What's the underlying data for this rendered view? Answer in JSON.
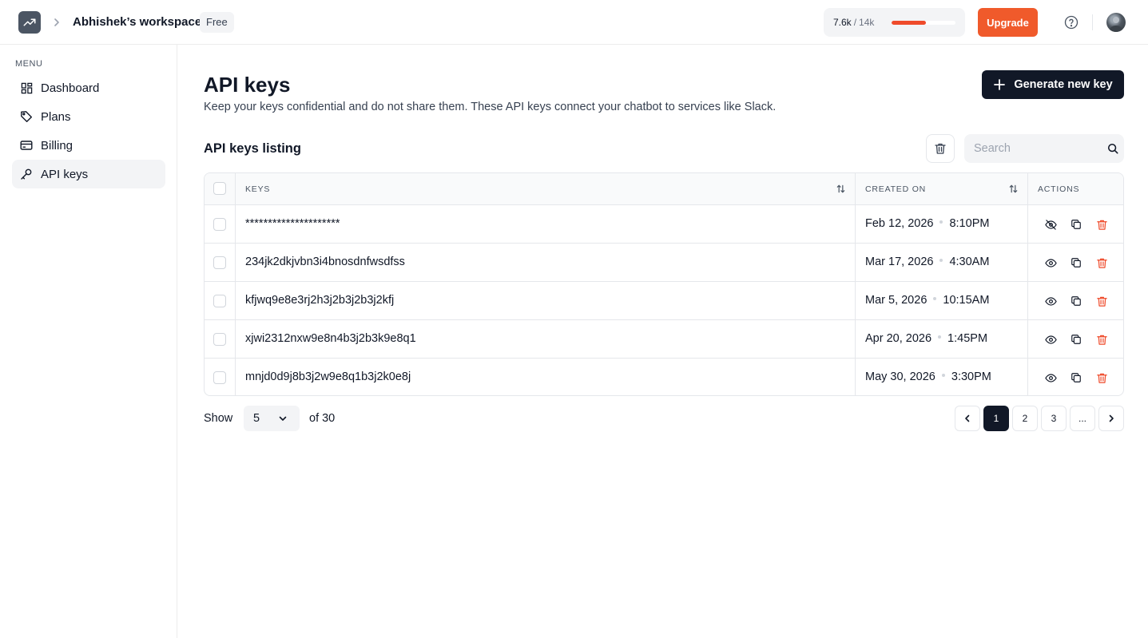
{
  "header": {
    "workspace_name": "Abhishek’s workspace",
    "plan_badge": "Free",
    "usage": {
      "used": "7.6k",
      "separator": "/",
      "limit": "14k",
      "fraction": 0.54
    },
    "upgrade_label": "Upgrade",
    "icons": {
      "logo": "trend-up-icon",
      "breadcrumb": "chevron-right-icon",
      "help": "help-circle-icon",
      "avatar": "user-avatar"
    }
  },
  "sidebar": {
    "menu_label": "MENU",
    "items": [
      {
        "label": "Dashboard",
        "icon": "dashboard-icon",
        "active": false
      },
      {
        "label": "Plans",
        "icon": "tag-icon",
        "active": false
      },
      {
        "label": "Billing",
        "icon": "credit-card-icon",
        "active": false
      },
      {
        "label": "API keys",
        "icon": "key-icon",
        "active": true
      }
    ]
  },
  "main": {
    "title": "API keys",
    "description": "Keep your keys confidential and do not share them. These API keys connect your chatbot to services like Slack.",
    "generate_label": "Generate new key",
    "listing_title": "API keys listing",
    "search_placeholder": "Search"
  },
  "table": {
    "headers": {
      "keys": "KEYS",
      "created_on": "CREATED ON",
      "actions": "ACTIONS"
    },
    "rows": [
      {
        "key": "*********************",
        "date": "Feb 12, 2026",
        "time": "8:10PM",
        "visibility_icon": "eye-off-icon"
      },
      {
        "key": "234jk2dkjvbn3i4bnosdnfwsdfss",
        "date": "Mar 17, 2026",
        "time": "4:30AM",
        "visibility_icon": "eye-icon"
      },
      {
        "key": "kfjwq9e8e3rj2h3j2b3j2b3j2kfj",
        "date": "Mar 5, 2026",
        "time": "10:15AM",
        "visibility_icon": "eye-icon"
      },
      {
        "key": "xjwi2312nxw9e8n4b3j2b3k9e8q1",
        "date": "Apr 20, 2026",
        "time": "1:45PM",
        "visibility_icon": "eye-icon"
      },
      {
        "key": "mnjd0d9j8b3j2w9e8q1b3j2k0e8j",
        "date": "May 30, 2026",
        "time": "3:30PM",
        "visibility_icon": "eye-icon"
      }
    ]
  },
  "pagination": {
    "show_label": "Show",
    "page_size": "5",
    "of_total": "of 30",
    "pages": [
      "1",
      "2",
      "3",
      "..."
    ],
    "current_page": "1"
  },
  "colors": {
    "accent": "#f05a2b",
    "primary_dark": "#111827",
    "danger": "#ef4b2b"
  }
}
